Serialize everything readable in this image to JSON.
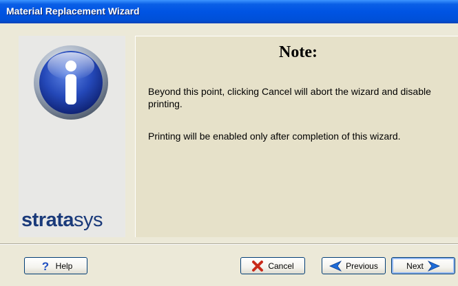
{
  "window": {
    "title": "Material Replacement Wizard"
  },
  "side_panel": {
    "icon": "info-icon",
    "brand_strong": "strata",
    "brand_light": "sys"
  },
  "content": {
    "heading": "Note:",
    "paragraph1": "Beyond this point, clicking Cancel will abort the wizard and disable printing.",
    "paragraph2": "Printing will be enabled only after completion of this wizard."
  },
  "buttons": {
    "help": {
      "label": "Help",
      "icon": "help-icon"
    },
    "cancel": {
      "label": "Cancel",
      "icon": "cancel-icon"
    },
    "previous": {
      "label": "Previous",
      "icon": "arrow-left-icon"
    },
    "next": {
      "label": "Next",
      "icon": "arrow-right-icon"
    }
  },
  "colors": {
    "titlebar": "#0054e3",
    "window_bg": "#ece9d8",
    "content_bg": "#e6e1c9",
    "brand": "#1a3a7a",
    "cancel_icon": "#c82a1a",
    "arrow_icon": "#1e6cd8"
  }
}
